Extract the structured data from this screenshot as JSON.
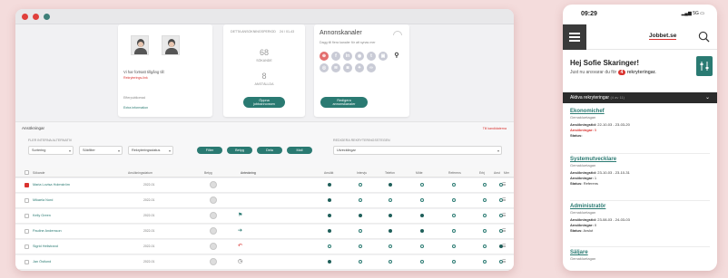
{
  "desktop": {
    "recruiter_card": {
      "text1": "Vi har fortsatt tillgång till:",
      "link1": "Rekryterings-link",
      "text2": "Efterpublicerad",
      "link2": "Extra information"
    },
    "stats_card": {
      "label": "DETTA ANSOKNINGSPERIOD",
      "range": "24 / 01-43",
      "num1": "68",
      "num1_label": "SÖKANDE",
      "num2": "8",
      "num2_label": "ANSTÄLLDA",
      "button": "Öppna jobbannonsen"
    },
    "channels_card": {
      "title": "Annonskanaler",
      "subtitle": "Dagg till flera kanaler för att synas mer",
      "button": "Redigera annonskanaler"
    },
    "filter": {
      "section_title": "Ansökningar",
      "section_link": "Till kandidaterna",
      "left_label": "FLER INTERNA ALTERNATIV",
      "select1": "Sortering",
      "select2": "Sökfilter",
      "select3": "Rekryteringsstatus",
      "buttons": [
        "Filter",
        "Betyg",
        "Dela",
        "Mail"
      ],
      "right_label": "REDIGERA REKRYTERINGSSTEGEN",
      "right_select": "Utvecklingar"
    },
    "columns": [
      "Sökande",
      "Ansökningsdatum",
      "Betyg",
      "Anteckning",
      "Ansökt",
      "Intervju",
      "Telefon",
      "Möte",
      "Referens",
      "Erbj",
      "Anst",
      "Mer"
    ],
    "rows": [
      {
        "name": "Maria Lovisa Holmström",
        "date": "2022-01",
        "score": "",
        "icon": "",
        "selected": true,
        "dots": [
          1,
          0,
          1,
          0,
          0,
          0,
          0
        ]
      },
      {
        "name": "Mikaela Nord",
        "date": "2022-01",
        "score": "",
        "icon": "",
        "selected": false,
        "dots": [
          1,
          0,
          0,
          0,
          0,
          0,
          0
        ]
      },
      {
        "name": "Kelly Green",
        "date": "2022-01",
        "score": "",
        "icon": "flag",
        "selected": false,
        "dots": [
          1,
          1,
          1,
          1,
          0,
          0,
          0
        ]
      },
      {
        "name": "Pauline Andersson",
        "date": "2022-01",
        "score": "",
        "icon": "arrow",
        "selected": false,
        "dots": [
          1,
          0,
          1,
          1,
          0,
          0,
          0
        ]
      },
      {
        "name": "Sigrid Hellstrand",
        "date": "2022-01",
        "score": "",
        "icon": "undo",
        "selected": false,
        "dots": [
          0,
          0,
          0,
          0,
          0,
          0,
          1
        ]
      },
      {
        "name": "Jan Östlund",
        "date": "2022-01",
        "score": "",
        "icon": "clock",
        "selected": false,
        "dots": [
          1,
          0,
          0,
          0,
          0,
          0,
          0
        ]
      },
      {
        "name": "Siri Lindberg",
        "date": "2022-01",
        "score": "",
        "icon": "note",
        "selected": false,
        "dots": [
          0,
          0,
          0,
          0,
          0,
          0,
          0
        ]
      }
    ]
  },
  "phone": {
    "time": "09:29",
    "signal": "5G",
    "logo": "Jobbet.se",
    "greeting": "Hej Sofie Skaringer!",
    "sub_prefix": "Just nu ansvarar du för",
    "count": "4",
    "sub_suffix": "rekryteringar.",
    "bar_title": "Aktiva rekryteringar",
    "bar_count": "(4 av 11)",
    "jobs": [
      {
        "title": "Ekonomichef",
        "location": "Gemakluetagan",
        "l1": "Ansökningstid:",
        "v1": "22-10-03 - 23-03-20",
        "l2": "Ansökningar:",
        "v2": "5",
        "l3": "Status:",
        "v3": "",
        "v2red": true
      },
      {
        "title": "Systemutvecklare",
        "location": "Gemakluetagan",
        "l1": "Ansökningstid:",
        "v1": "23-10-03 - 23-10-31",
        "l2": "Ansökningar:",
        "v2": "1",
        "l3": "Status:",
        "v3": "Referens",
        "v2red": false
      },
      {
        "title": "Administratör",
        "location": "Gemakluetagan",
        "l1": "Ansökningstid:",
        "v1": "23-08-03 - 24-03-03",
        "l2": "Ansökningar:",
        "v2": "0",
        "l3": "Status:",
        "v3": "Avslut",
        "v2red": false
      },
      {
        "title": "Säljare",
        "location": "Gemakluetagan",
        "l1": "",
        "v1": "",
        "l2": "",
        "v2": "",
        "l3": "",
        "v3": "",
        "v2red": false
      }
    ]
  }
}
